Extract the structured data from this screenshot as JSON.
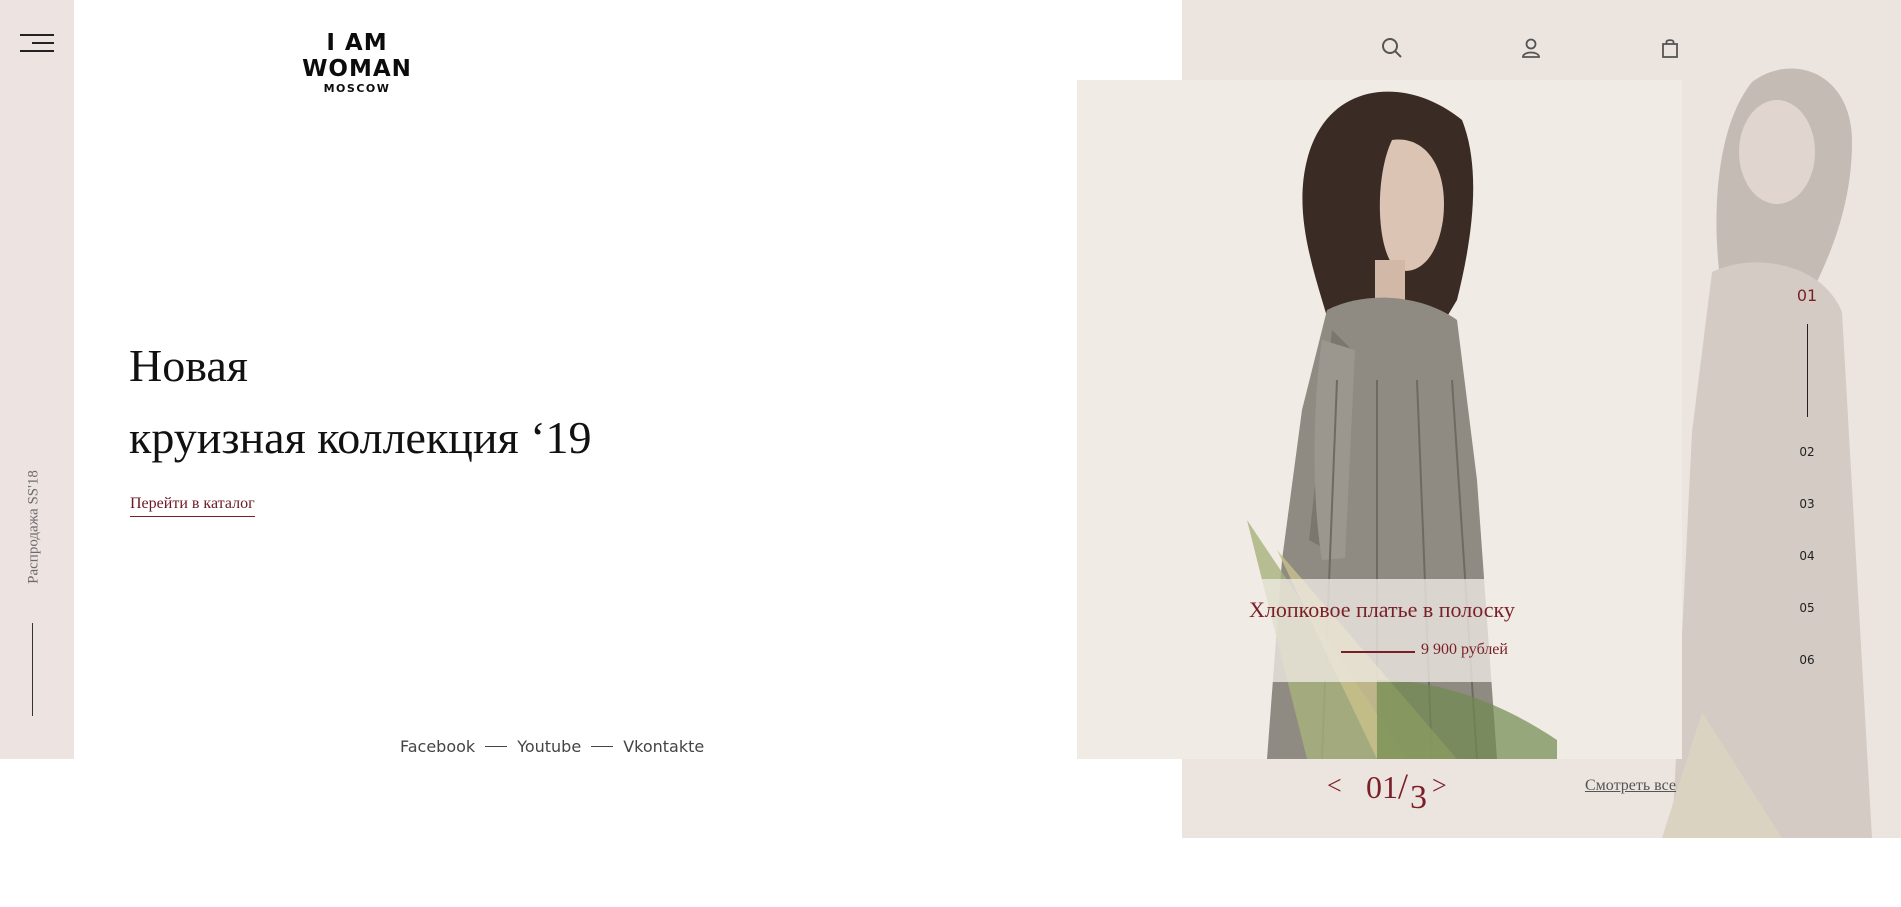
{
  "brand": {
    "name": "I AM WOMAN",
    "city": "MOSCOW"
  },
  "sidebar": {
    "vertical_text": "Распродажа SS'18"
  },
  "hero": {
    "title_line1": "Новая",
    "title_line2": "круизная коллекция ‘19",
    "cta": "Перейти в каталог"
  },
  "social": [
    {
      "label": "Facebook"
    },
    {
      "label": "Youtube"
    },
    {
      "label": "Vkontakte"
    }
  ],
  "header_icons": [
    "search-icon",
    "user-icon",
    "bag-icon"
  ],
  "product": {
    "title": "Хлопковое платье в полоску",
    "price": "9 900 рублей"
  },
  "pager": {
    "items": [
      "01",
      "02",
      "03",
      "04",
      "05",
      "06"
    ],
    "active": "01"
  },
  "slider": {
    "prev": "<",
    "next": ">",
    "current": "01",
    "total": "3",
    "view_all": "Смотреть все"
  },
  "colors": {
    "accent": "#7a1f28",
    "sidebar_bg": "#ede4e1",
    "panel_bg": "#ece5df",
    "card_bg": "#f0ebe4"
  }
}
